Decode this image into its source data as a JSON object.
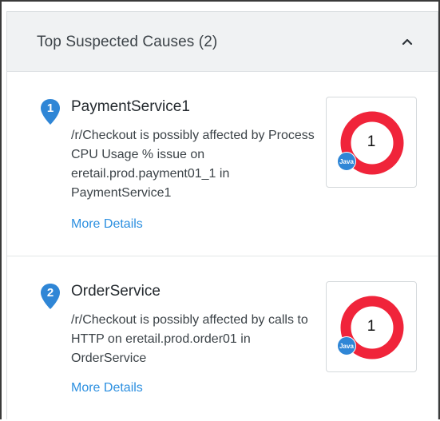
{
  "panel": {
    "title": "Top Suspected Causes (2)",
    "collapse_icon": "chevron-up-icon"
  },
  "causes": [
    {
      "rank": "1",
      "name": "PaymentService1",
      "description": "/r/Checkout is possibly affected by Process CPU Usage % issue on eretail.prod.payment01_1 in PaymentService1",
      "more_details": "More Details",
      "donut_count": "1",
      "tech_badge": "Java",
      "donut_color": "#f0243a",
      "badge_color": "#2f86d6"
    },
    {
      "rank": "2",
      "name": "OrderService",
      "description": "/r/Checkout is possibly affected by calls to HTTP on eretail.prod.order01 in OrderService",
      "more_details": "More Details",
      "donut_count": "1",
      "tech_badge": "Java",
      "donut_color": "#f0243a",
      "badge_color": "#2f86d6"
    }
  ],
  "colors": {
    "rank_pin": "#2f86d6",
    "link": "#2b8fe0",
    "header_bg": "#f0f2f3"
  }
}
